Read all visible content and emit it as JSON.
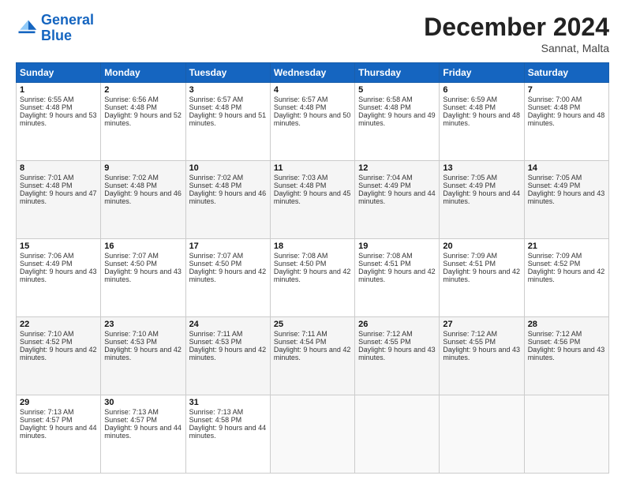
{
  "logo": {
    "line1": "General",
    "line2": "Blue"
  },
  "title": "December 2024",
  "subtitle": "Sannat, Malta",
  "headers": [
    "Sunday",
    "Monday",
    "Tuesday",
    "Wednesday",
    "Thursday",
    "Friday",
    "Saturday"
  ],
  "weeks": [
    [
      {
        "day": "1",
        "sunrise": "Sunrise: 6:55 AM",
        "sunset": "Sunset: 4:48 PM",
        "daylight": "Daylight: 9 hours and 53 minutes."
      },
      {
        "day": "2",
        "sunrise": "Sunrise: 6:56 AM",
        "sunset": "Sunset: 4:48 PM",
        "daylight": "Daylight: 9 hours and 52 minutes."
      },
      {
        "day": "3",
        "sunrise": "Sunrise: 6:57 AM",
        "sunset": "Sunset: 4:48 PM",
        "daylight": "Daylight: 9 hours and 51 minutes."
      },
      {
        "day": "4",
        "sunrise": "Sunrise: 6:57 AM",
        "sunset": "Sunset: 4:48 PM",
        "daylight": "Daylight: 9 hours and 50 minutes."
      },
      {
        "day": "5",
        "sunrise": "Sunrise: 6:58 AM",
        "sunset": "Sunset: 4:48 PM",
        "daylight": "Daylight: 9 hours and 49 minutes."
      },
      {
        "day": "6",
        "sunrise": "Sunrise: 6:59 AM",
        "sunset": "Sunset: 4:48 PM",
        "daylight": "Daylight: 9 hours and 48 minutes."
      },
      {
        "day": "7",
        "sunrise": "Sunrise: 7:00 AM",
        "sunset": "Sunset: 4:48 PM",
        "daylight": "Daylight: 9 hours and 48 minutes."
      }
    ],
    [
      {
        "day": "8",
        "sunrise": "Sunrise: 7:01 AM",
        "sunset": "Sunset: 4:48 PM",
        "daylight": "Daylight: 9 hours and 47 minutes."
      },
      {
        "day": "9",
        "sunrise": "Sunrise: 7:02 AM",
        "sunset": "Sunset: 4:48 PM",
        "daylight": "Daylight: 9 hours and 46 minutes."
      },
      {
        "day": "10",
        "sunrise": "Sunrise: 7:02 AM",
        "sunset": "Sunset: 4:48 PM",
        "daylight": "Daylight: 9 hours and 46 minutes."
      },
      {
        "day": "11",
        "sunrise": "Sunrise: 7:03 AM",
        "sunset": "Sunset: 4:48 PM",
        "daylight": "Daylight: 9 hours and 45 minutes."
      },
      {
        "day": "12",
        "sunrise": "Sunrise: 7:04 AM",
        "sunset": "Sunset: 4:49 PM",
        "daylight": "Daylight: 9 hours and 44 minutes."
      },
      {
        "day": "13",
        "sunrise": "Sunrise: 7:05 AM",
        "sunset": "Sunset: 4:49 PM",
        "daylight": "Daylight: 9 hours and 44 minutes."
      },
      {
        "day": "14",
        "sunrise": "Sunrise: 7:05 AM",
        "sunset": "Sunset: 4:49 PM",
        "daylight": "Daylight: 9 hours and 43 minutes."
      }
    ],
    [
      {
        "day": "15",
        "sunrise": "Sunrise: 7:06 AM",
        "sunset": "Sunset: 4:49 PM",
        "daylight": "Daylight: 9 hours and 43 minutes."
      },
      {
        "day": "16",
        "sunrise": "Sunrise: 7:07 AM",
        "sunset": "Sunset: 4:50 PM",
        "daylight": "Daylight: 9 hours and 43 minutes."
      },
      {
        "day": "17",
        "sunrise": "Sunrise: 7:07 AM",
        "sunset": "Sunset: 4:50 PM",
        "daylight": "Daylight: 9 hours and 42 minutes."
      },
      {
        "day": "18",
        "sunrise": "Sunrise: 7:08 AM",
        "sunset": "Sunset: 4:50 PM",
        "daylight": "Daylight: 9 hours and 42 minutes."
      },
      {
        "day": "19",
        "sunrise": "Sunrise: 7:08 AM",
        "sunset": "Sunset: 4:51 PM",
        "daylight": "Daylight: 9 hours and 42 minutes."
      },
      {
        "day": "20",
        "sunrise": "Sunrise: 7:09 AM",
        "sunset": "Sunset: 4:51 PM",
        "daylight": "Daylight: 9 hours and 42 minutes."
      },
      {
        "day": "21",
        "sunrise": "Sunrise: 7:09 AM",
        "sunset": "Sunset: 4:52 PM",
        "daylight": "Daylight: 9 hours and 42 minutes."
      }
    ],
    [
      {
        "day": "22",
        "sunrise": "Sunrise: 7:10 AM",
        "sunset": "Sunset: 4:52 PM",
        "daylight": "Daylight: 9 hours and 42 minutes."
      },
      {
        "day": "23",
        "sunrise": "Sunrise: 7:10 AM",
        "sunset": "Sunset: 4:53 PM",
        "daylight": "Daylight: 9 hours and 42 minutes."
      },
      {
        "day": "24",
        "sunrise": "Sunrise: 7:11 AM",
        "sunset": "Sunset: 4:53 PM",
        "daylight": "Daylight: 9 hours and 42 minutes."
      },
      {
        "day": "25",
        "sunrise": "Sunrise: 7:11 AM",
        "sunset": "Sunset: 4:54 PM",
        "daylight": "Daylight: 9 hours and 42 minutes."
      },
      {
        "day": "26",
        "sunrise": "Sunrise: 7:12 AM",
        "sunset": "Sunset: 4:55 PM",
        "daylight": "Daylight: 9 hours and 43 minutes."
      },
      {
        "day": "27",
        "sunrise": "Sunrise: 7:12 AM",
        "sunset": "Sunset: 4:55 PM",
        "daylight": "Daylight: 9 hours and 43 minutes."
      },
      {
        "day": "28",
        "sunrise": "Sunrise: 7:12 AM",
        "sunset": "Sunset: 4:56 PM",
        "daylight": "Daylight: 9 hours and 43 minutes."
      }
    ],
    [
      {
        "day": "29",
        "sunrise": "Sunrise: 7:13 AM",
        "sunset": "Sunset: 4:57 PM",
        "daylight": "Daylight: 9 hours and 44 minutes."
      },
      {
        "day": "30",
        "sunrise": "Sunrise: 7:13 AM",
        "sunset": "Sunset: 4:57 PM",
        "daylight": "Daylight: 9 hours and 44 minutes."
      },
      {
        "day": "31",
        "sunrise": "Sunrise: 7:13 AM",
        "sunset": "Sunset: 4:58 PM",
        "daylight": "Daylight: 9 hours and 44 minutes."
      },
      null,
      null,
      null,
      null
    ]
  ]
}
